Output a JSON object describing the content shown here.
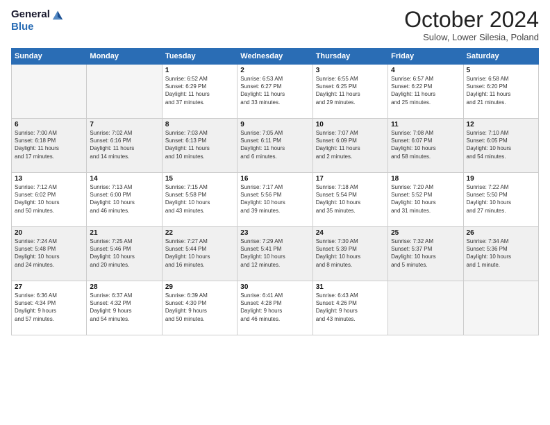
{
  "logo": {
    "line1": "General",
    "line2": "Blue"
  },
  "title": "October 2024",
  "location": "Sulow, Lower Silesia, Poland",
  "headers": [
    "Sunday",
    "Monday",
    "Tuesday",
    "Wednesday",
    "Thursday",
    "Friday",
    "Saturday"
  ],
  "weeks": [
    [
      {
        "day": "",
        "info": ""
      },
      {
        "day": "",
        "info": ""
      },
      {
        "day": "1",
        "info": "Sunrise: 6:52 AM\nSunset: 6:29 PM\nDaylight: 11 hours\nand 37 minutes."
      },
      {
        "day": "2",
        "info": "Sunrise: 6:53 AM\nSunset: 6:27 PM\nDaylight: 11 hours\nand 33 minutes."
      },
      {
        "day": "3",
        "info": "Sunrise: 6:55 AM\nSunset: 6:25 PM\nDaylight: 11 hours\nand 29 minutes."
      },
      {
        "day": "4",
        "info": "Sunrise: 6:57 AM\nSunset: 6:22 PM\nDaylight: 11 hours\nand 25 minutes."
      },
      {
        "day": "5",
        "info": "Sunrise: 6:58 AM\nSunset: 6:20 PM\nDaylight: 11 hours\nand 21 minutes."
      }
    ],
    [
      {
        "day": "6",
        "info": "Sunrise: 7:00 AM\nSunset: 6:18 PM\nDaylight: 11 hours\nand 17 minutes."
      },
      {
        "day": "7",
        "info": "Sunrise: 7:02 AM\nSunset: 6:16 PM\nDaylight: 11 hours\nand 14 minutes."
      },
      {
        "day": "8",
        "info": "Sunrise: 7:03 AM\nSunset: 6:13 PM\nDaylight: 11 hours\nand 10 minutes."
      },
      {
        "day": "9",
        "info": "Sunrise: 7:05 AM\nSunset: 6:11 PM\nDaylight: 11 hours\nand 6 minutes."
      },
      {
        "day": "10",
        "info": "Sunrise: 7:07 AM\nSunset: 6:09 PM\nDaylight: 11 hours\nand 2 minutes."
      },
      {
        "day": "11",
        "info": "Sunrise: 7:08 AM\nSunset: 6:07 PM\nDaylight: 10 hours\nand 58 minutes."
      },
      {
        "day": "12",
        "info": "Sunrise: 7:10 AM\nSunset: 6:05 PM\nDaylight: 10 hours\nand 54 minutes."
      }
    ],
    [
      {
        "day": "13",
        "info": "Sunrise: 7:12 AM\nSunset: 6:02 PM\nDaylight: 10 hours\nand 50 minutes."
      },
      {
        "day": "14",
        "info": "Sunrise: 7:13 AM\nSunset: 6:00 PM\nDaylight: 10 hours\nand 46 minutes."
      },
      {
        "day": "15",
        "info": "Sunrise: 7:15 AM\nSunset: 5:58 PM\nDaylight: 10 hours\nand 43 minutes."
      },
      {
        "day": "16",
        "info": "Sunrise: 7:17 AM\nSunset: 5:56 PM\nDaylight: 10 hours\nand 39 minutes."
      },
      {
        "day": "17",
        "info": "Sunrise: 7:18 AM\nSunset: 5:54 PM\nDaylight: 10 hours\nand 35 minutes."
      },
      {
        "day": "18",
        "info": "Sunrise: 7:20 AM\nSunset: 5:52 PM\nDaylight: 10 hours\nand 31 minutes."
      },
      {
        "day": "19",
        "info": "Sunrise: 7:22 AM\nSunset: 5:50 PM\nDaylight: 10 hours\nand 27 minutes."
      }
    ],
    [
      {
        "day": "20",
        "info": "Sunrise: 7:24 AM\nSunset: 5:48 PM\nDaylight: 10 hours\nand 24 minutes."
      },
      {
        "day": "21",
        "info": "Sunrise: 7:25 AM\nSunset: 5:46 PM\nDaylight: 10 hours\nand 20 minutes."
      },
      {
        "day": "22",
        "info": "Sunrise: 7:27 AM\nSunset: 5:44 PM\nDaylight: 10 hours\nand 16 minutes."
      },
      {
        "day": "23",
        "info": "Sunrise: 7:29 AM\nSunset: 5:41 PM\nDaylight: 10 hours\nand 12 minutes."
      },
      {
        "day": "24",
        "info": "Sunrise: 7:30 AM\nSunset: 5:39 PM\nDaylight: 10 hours\nand 8 minutes."
      },
      {
        "day": "25",
        "info": "Sunrise: 7:32 AM\nSunset: 5:37 PM\nDaylight: 10 hours\nand 5 minutes."
      },
      {
        "day": "26",
        "info": "Sunrise: 7:34 AM\nSunset: 5:36 PM\nDaylight: 10 hours\nand 1 minute."
      }
    ],
    [
      {
        "day": "27",
        "info": "Sunrise: 6:36 AM\nSunset: 4:34 PM\nDaylight: 9 hours\nand 57 minutes."
      },
      {
        "day": "28",
        "info": "Sunrise: 6:37 AM\nSunset: 4:32 PM\nDaylight: 9 hours\nand 54 minutes."
      },
      {
        "day": "29",
        "info": "Sunrise: 6:39 AM\nSunset: 4:30 PM\nDaylight: 9 hours\nand 50 minutes."
      },
      {
        "day": "30",
        "info": "Sunrise: 6:41 AM\nSunset: 4:28 PM\nDaylight: 9 hours\nand 46 minutes."
      },
      {
        "day": "31",
        "info": "Sunrise: 6:43 AM\nSunset: 4:26 PM\nDaylight: 9 hours\nand 43 minutes."
      },
      {
        "day": "",
        "info": ""
      },
      {
        "day": "",
        "info": ""
      }
    ]
  ]
}
